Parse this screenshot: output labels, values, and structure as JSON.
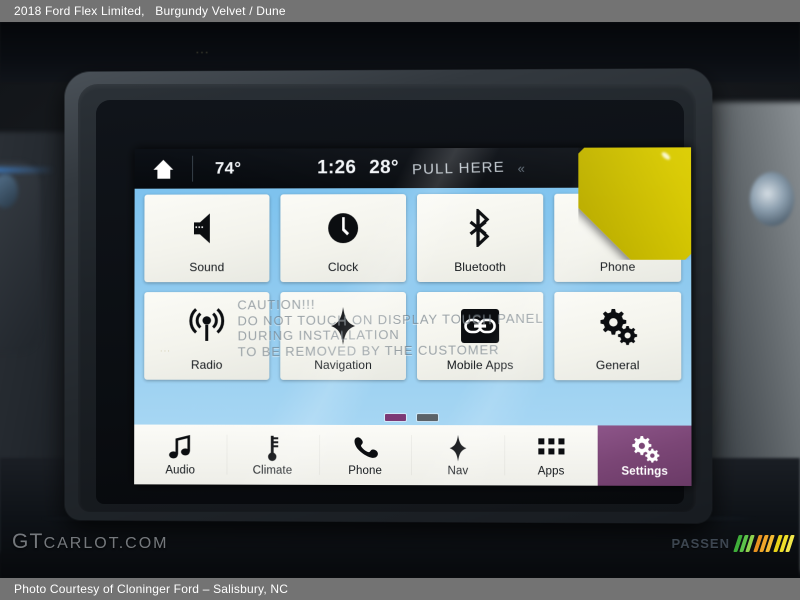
{
  "top_caption": {
    "vehicle": "2018 Ford Flex Limited,",
    "colors": "Burgundy Velvet / Dune"
  },
  "bottom_caption": {
    "text": "Photo Courtesy of Cloninger Ford – Salisbury, NC"
  },
  "watermark": {
    "prefix": "GT",
    "suffix": "CARLOT.COM"
  },
  "badge": {
    "text": "PASSEN",
    "stripe_colors": [
      "#3fae3a",
      "#5cc24a",
      "#8fd24e",
      "#e8921f",
      "#f0a62a",
      "#f4bb33",
      "#e8d318",
      "#eedf2a",
      "#f2e84a"
    ]
  },
  "screen": {
    "statusbar": {
      "home_icon": "home-icon",
      "cabin_temp": "74°",
      "clock": "1:26",
      "outside_temp": "28°",
      "pull_here": "PULL HERE",
      "arrows": "«"
    },
    "tiles": [
      {
        "label": "Sound",
        "icon": "speaker-icon"
      },
      {
        "label": "Clock",
        "icon": "clock-icon"
      },
      {
        "label": "Bluetooth",
        "icon": "bluetooth-icon"
      },
      {
        "label": "Phone",
        "icon": "phone-handset-icon"
      },
      {
        "label": "Radio",
        "icon": "radio-broadcast-icon"
      },
      {
        "label": "Navigation",
        "icon": "compass-star-icon"
      },
      {
        "label": "Mobile Apps",
        "icon": "chain-link-icon"
      },
      {
        "label": "General",
        "icon": "gears-icon"
      }
    ],
    "page_dots": [
      {
        "state": "active"
      },
      {
        "state": "inactive"
      }
    ],
    "tabs": [
      {
        "label": "Audio",
        "icon": "music-note-icon",
        "active": false
      },
      {
        "label": "Climate",
        "icon": "thermometer-icon",
        "active": false
      },
      {
        "label": "Phone",
        "icon": "phone-handset-icon",
        "active": false
      },
      {
        "label": "Nav",
        "icon": "compass-star-icon",
        "active": false
      },
      {
        "label": "Apps",
        "icon": "grid-apps-icon",
        "active": false
      },
      {
        "label": "Settings",
        "icon": "gears-icon",
        "active": true
      }
    ],
    "film_overlay": {
      "line1": "CAUTION!!!",
      "line2": "DO NOT TOUCH ON DISPLAY TOUCH PANEL",
      "line3": "DURING INSTALLATION",
      "line4": "TO BE REMOVED BY THE CUSTOMER"
    },
    "colors": {
      "background_blue": "#8ec9ee",
      "tile_cream": "#f5f5ee",
      "active_tab_purple": "#7a4675",
      "film_yellow": "#d6c800",
      "statusbar_black": "#080b0f"
    }
  }
}
